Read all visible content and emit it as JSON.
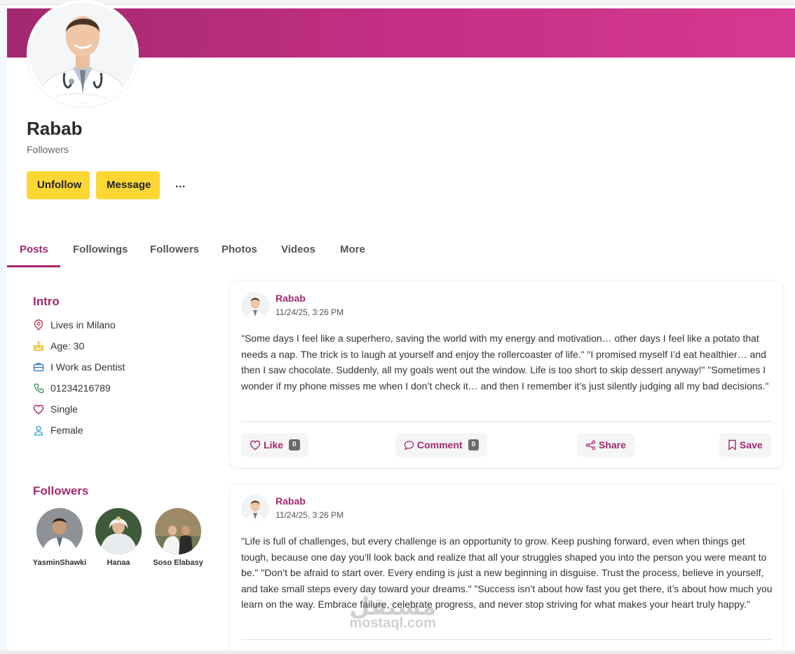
{
  "profile": {
    "name": "Rabab",
    "subtitle": "Followers",
    "unfollow_label": "Unfollow",
    "message_label": "Message",
    "more_label": "..."
  },
  "tabs": [
    {
      "label": "Posts",
      "active": true
    },
    {
      "label": "Followings",
      "active": false
    },
    {
      "label": "Followers",
      "active": false
    },
    {
      "label": "Photos",
      "active": false
    },
    {
      "label": "Videos",
      "active": false
    },
    {
      "label": "More",
      "active": false
    }
  ],
  "intro": {
    "title": "Intro",
    "items": [
      {
        "icon": "location-pin-icon",
        "text": "Lives in Milano"
      },
      {
        "icon": "cake-icon",
        "text": "Age: 30"
      },
      {
        "icon": "briefcase-icon",
        "text": "I Work as Dentist"
      },
      {
        "icon": "phone-icon",
        "text": "01234216789"
      },
      {
        "icon": "heart-icon",
        "text": "Single"
      },
      {
        "icon": "person-icon",
        "text": "Female"
      }
    ]
  },
  "followers": {
    "title": "Followers",
    "items": [
      {
        "name": "YasminShawki"
      },
      {
        "name": "Hanaa"
      },
      {
        "name": "Soso Elabasy"
      }
    ]
  },
  "posts": [
    {
      "author": "Rabab",
      "date": "11/24/25, 3:26 PM",
      "text": "\"Some days I feel like a superhero, saving the world with my energy and motivation… other days I feel like a potato that needs a nap. The trick is to laugh at yourself and enjoy the rollercoaster of life.\" \"I promised myself I’d eat healthier… and then I saw chocolate. Suddenly, all my goals went out the window. Life is too short to skip dessert anyway!\" \"Sometimes I wonder if my phone misses me when I don’t check it… and then I remember it’s just silently judging all my bad decisions.\"",
      "like_label": "Like",
      "like_count": "0",
      "comment_label": "Comment",
      "comment_count": "0",
      "share_label": "Share",
      "save_label": "Save"
    },
    {
      "author": "Rabab",
      "date": "11/24/25, 3:26 PM",
      "text": "\"Life is full of challenges, but every challenge is an opportunity to grow. Keep pushing forward, even when things get tough, because one day you’ll look back and realize that all your struggles shaped you into the person you were meant to be.\" \"Don’t be afraid to start over. Every ending is just a new beginning in disguise. Trust the process, believe in yourself, and take small steps every day toward your dreams.\" \"Success isn’t about how fast you get there, it’s about how much you learn on the way. Embrace failure, celebrate progress, and never stop striving for what makes your heart truly happy.\""
    }
  ],
  "watermark": {
    "arabic": "مستقل",
    "latin": "mostaql.com"
  },
  "colors": {
    "accent": "#a3286f",
    "cover_end": "#d63991",
    "button": "#fcd734"
  }
}
